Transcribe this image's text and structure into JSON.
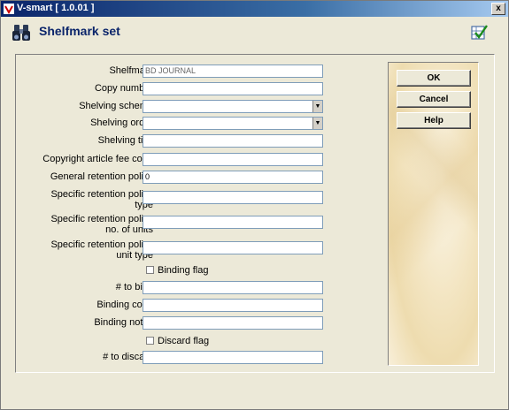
{
  "window": {
    "title": "V-smart [ 1.0.01 ]",
    "close_label": "x"
  },
  "header": {
    "title": "Shelfmark set"
  },
  "form": {
    "shelfmark": {
      "label": "Shelfmark",
      "value": "BD JOURNAL"
    },
    "copy_number": {
      "label": "Copy number",
      "value": ""
    },
    "shelving_scheme": {
      "label": "Shelving scheme",
      "value": ""
    },
    "shelving_order": {
      "label": "Shelving order",
      "value": ""
    },
    "shelving_title": {
      "label": "Shelving title",
      "value": ""
    },
    "copyright_fee_code": {
      "label": "Copyright article fee code",
      "value": ""
    },
    "general_retention_policy": {
      "label": "General retention policy",
      "value": "0"
    },
    "specific_retention_type": {
      "label_line1": "Specific retention policy",
      "label_line2": "type",
      "value": ""
    },
    "specific_retention_units": {
      "label_line1": "Specific retention policy",
      "label_line2": "no. of units",
      "value": ""
    },
    "specific_retention_unit_type": {
      "label_line1": "Specific retention policy",
      "label_line2": "unit type",
      "value": ""
    },
    "binding_flag": {
      "label": "Binding flag",
      "checked": false
    },
    "to_bind": {
      "label": "# to bind",
      "value": ""
    },
    "binding_color": {
      "label": "Binding color",
      "value": ""
    },
    "binding_notes": {
      "label": "Binding notes",
      "value": ""
    },
    "discard_flag": {
      "label": "Discard flag",
      "checked": false
    },
    "to_discard": {
      "label": "# to discard",
      "value": ""
    }
  },
  "buttons": {
    "ok": "OK",
    "cancel": "Cancel",
    "help": "Help"
  },
  "icons": {
    "app": "vsmart-icon",
    "heading": "binoculars-icon",
    "help": "check-help-icon",
    "dropdown": "triangle-down"
  },
  "colors": {
    "title_bar": "#0a246a",
    "heading": "#0a246a",
    "panel": "#ece9d8"
  }
}
